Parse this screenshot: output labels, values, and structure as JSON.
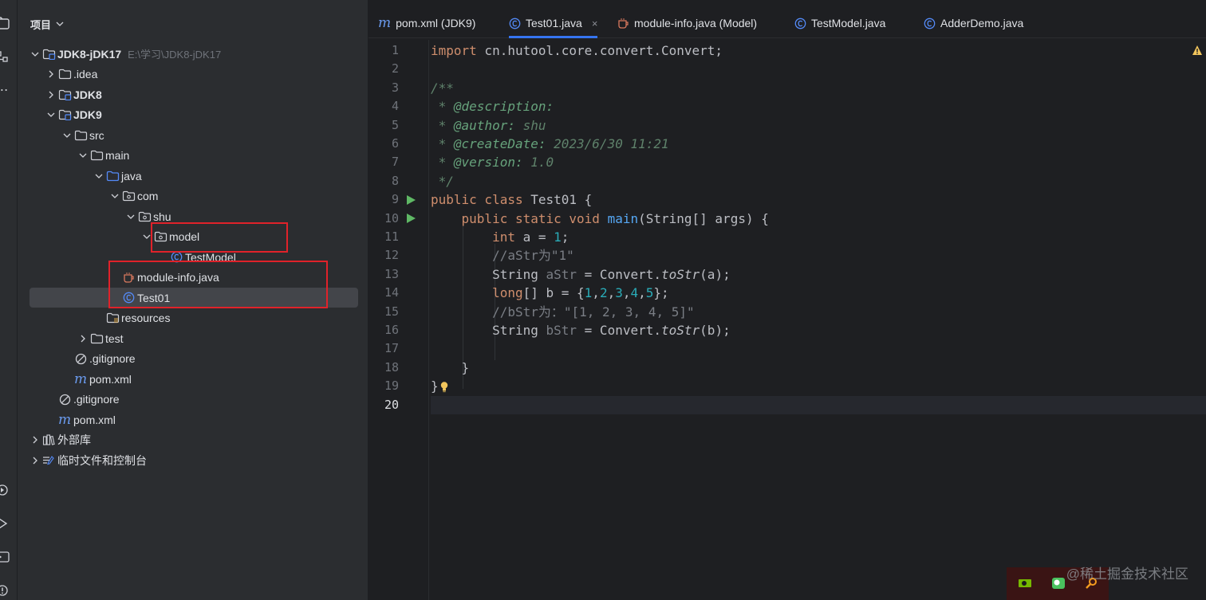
{
  "project_panel": {
    "title": "项目",
    "tree": [
      {
        "label": "JDK8-jDK17",
        "path": "E:\\学习\\JDK8-jDK17",
        "icon": "module-folder-icon",
        "expanded": true,
        "bold": true
      },
      {
        "label": ".idea",
        "icon": "folder-icon",
        "expanded": false
      },
      {
        "label": "JDK8",
        "icon": "module-folder-icon",
        "expanded": false,
        "bold": true
      },
      {
        "label": "JDK9",
        "icon": "module-folder-icon",
        "expanded": true,
        "bold": true
      },
      {
        "label": "src",
        "icon": "folder-icon",
        "expanded": true
      },
      {
        "label": "main",
        "icon": "folder-icon",
        "expanded": true
      },
      {
        "label": "java",
        "icon": "source-folder-icon",
        "expanded": true
      },
      {
        "label": "com",
        "icon": "package-icon",
        "expanded": true
      },
      {
        "label": "shu",
        "icon": "package-icon",
        "expanded": true
      },
      {
        "label": "model",
        "icon": "package-icon",
        "expanded": true
      },
      {
        "label": "TestModel",
        "icon": "class-icon"
      },
      {
        "label": "module-info.java",
        "icon": "java-file-icon"
      },
      {
        "label": "Test01",
        "icon": "class-icon",
        "selected": true
      },
      {
        "label": "resources",
        "icon": "resources-folder-icon"
      },
      {
        "label": "test",
        "icon": "folder-icon",
        "expanded": false
      },
      {
        "label": ".gitignore",
        "icon": "gitignore-icon"
      },
      {
        "label": "pom.xml",
        "icon": "maven-icon"
      },
      {
        "label": ".gitignore",
        "icon": "gitignore-icon"
      },
      {
        "label": "pom.xml",
        "icon": "maven-icon"
      },
      {
        "label": "外部库",
        "icon": "library-icon",
        "expanded": false
      },
      {
        "label": "临时文件和控制台",
        "icon": "scratches-icon",
        "expanded": false
      }
    ]
  },
  "editor": {
    "tabs": [
      {
        "label": "pom.xml (JDK9)",
        "icon": "maven-icon"
      },
      {
        "label": "Test01.java",
        "icon": "class-icon",
        "active": true,
        "closable": true
      },
      {
        "label": "module-info.java (Model)",
        "icon": "java-file-icon"
      },
      {
        "label": "TestModel.java",
        "icon": "class-icon"
      },
      {
        "label": "AdderDemo.java",
        "icon": "class-icon"
      }
    ],
    "line_numbers": [
      "1",
      "2",
      "3",
      "4",
      "5",
      "6",
      "7",
      "8",
      "9",
      "10",
      "11",
      "12",
      "13",
      "14",
      "15",
      "16",
      "17",
      "18",
      "19",
      "20"
    ],
    "current_line": "20",
    "code": {
      "l1_kw": "import",
      "l1_rest": " cn.hutool.core.convert.Convert;",
      "l3": "/**",
      "l4_star": " * ",
      "l4_tag": "@description:",
      "l5_star": " * ",
      "l5_tag": "@author:",
      "l5_val": " shu",
      "l6_star": " * ",
      "l6_tag": "@createDate:",
      "l6_val": " 2023/6/30 11:21",
      "l7_star": " * ",
      "l7_tag": "@version:",
      "l7_val": " 1.0",
      "l8": " */",
      "l9_kw": "public class",
      "l9_rest": " Test01 {",
      "l10_kw": "    public static void",
      "l10_fn": "main",
      "l10_rest": "(String[] args) {",
      "l11_kw": "        int",
      "l11_mid": " a = ",
      "l11_num": "1",
      "l11_end": ";",
      "l12": "        //aStr为\"1\"",
      "l13_a": "        String ",
      "l13_var": "aStr",
      "l13_b": " = Convert.",
      "l13_m": "toStr",
      "l13_c": "(a);",
      "l14_kw": "        long",
      "l14_a": "[] b = {",
      "l14_n1": "1",
      "l14_n2": "2",
      "l14_n3": "3",
      "l14_n4": "4",
      "l14_n5": "5",
      "l14_end": "};",
      "l15": "        //bStr为：\"[1, 2, 3, 4, 5]\"",
      "l16_a": "        String ",
      "l16_var": "bStr",
      "l16_b": " = Convert.",
      "l16_m": "toStr",
      "l16_c": "(b);",
      "l18": "    }",
      "l19": "}"
    }
  },
  "watermark": "@稀土掘金技术社区",
  "colors": {
    "accent": "#3574f0",
    "highlight_box": "#e0222a",
    "keyword": "#cf8e6d",
    "function": "#56a8f5",
    "number": "#2aacb8"
  }
}
